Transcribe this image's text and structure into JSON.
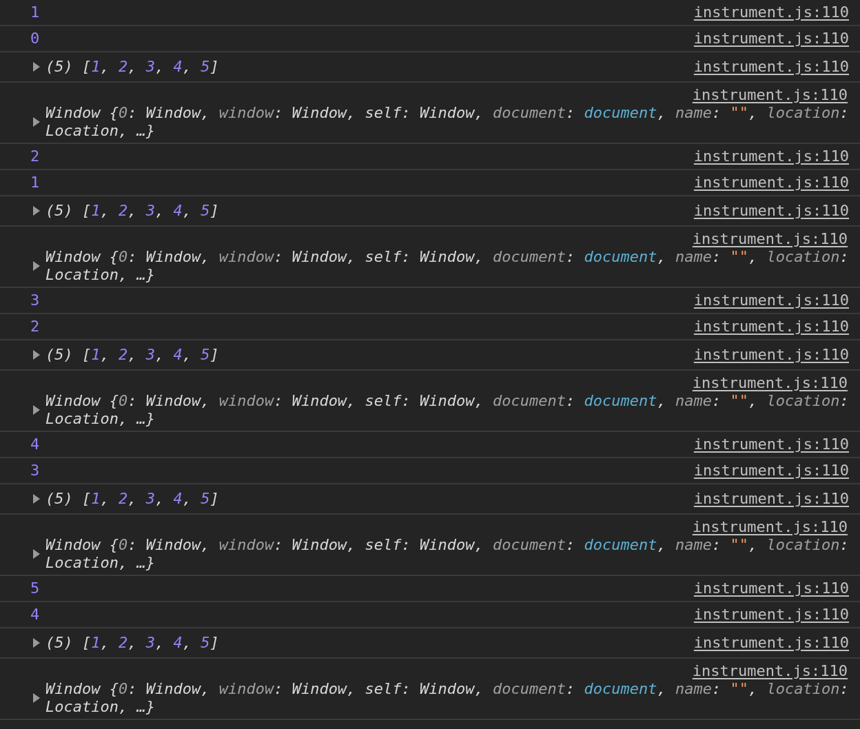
{
  "console": {
    "messages": [
      {
        "kind": "number",
        "value": "1",
        "source": "instrument.js:110"
      },
      {
        "kind": "number",
        "value": "0",
        "source": "instrument.js:110"
      },
      {
        "kind": "array",
        "expanded": false,
        "source": "instrument.js:110",
        "parts": [
          {
            "text": "(5) [",
            "color": "#d8d8d8"
          },
          {
            "text": "1",
            "color": "#9980ff"
          },
          {
            "text": ", ",
            "color": "#d8d8d8"
          },
          {
            "text": "2",
            "color": "#9980ff"
          },
          {
            "text": ", ",
            "color": "#d8d8d8"
          },
          {
            "text": "3",
            "color": "#9980ff"
          },
          {
            "text": ", ",
            "color": "#d8d8d8"
          },
          {
            "text": "4",
            "color": "#9980ff"
          },
          {
            "text": ", ",
            "color": "#d8d8d8"
          },
          {
            "text": "5",
            "color": "#9980ff"
          },
          {
            "text": "]",
            "color": "#d8d8d8"
          }
        ]
      },
      {
        "kind": "object",
        "expanded": false,
        "source": "instrument.js:110",
        "parts": [
          {
            "text": "Window {",
            "color": "#d8d8d8"
          },
          {
            "text": "0",
            "color": "#a0a0a0"
          },
          {
            "text": ": Window, ",
            "color": "#d8d8d8"
          },
          {
            "text": "window",
            "color": "#a0a0a0"
          },
          {
            "text": ": Window, self: Window, ",
            "color": "#d8d8d8"
          },
          {
            "text": "document",
            "color": "#a0a0a0"
          },
          {
            "text": ": ",
            "color": "#d8d8d8"
          },
          {
            "text": "document",
            "color": "#5db0d7"
          },
          {
            "text": ", ",
            "color": "#d8d8d8"
          },
          {
            "text": "name",
            "color": "#a0a0a0"
          },
          {
            "text": ": ",
            "color": "#d8d8d8"
          },
          {
            "text": "\"\"",
            "color": "#f29766"
          },
          {
            "text": ", ",
            "color": "#d8d8d8"
          },
          {
            "text": "location",
            "color": "#a0a0a0"
          },
          {
            "text": ": Location, …}",
            "color": "#d8d8d8"
          }
        ]
      },
      {
        "kind": "number",
        "value": "2",
        "source": "instrument.js:110"
      },
      {
        "kind": "number",
        "value": "1",
        "source": "instrument.js:110"
      },
      {
        "kind": "array",
        "expanded": false,
        "source": "instrument.js:110",
        "parts": [
          {
            "text": "(5) [",
            "color": "#d8d8d8"
          },
          {
            "text": "1",
            "color": "#9980ff"
          },
          {
            "text": ", ",
            "color": "#d8d8d8"
          },
          {
            "text": "2",
            "color": "#9980ff"
          },
          {
            "text": ", ",
            "color": "#d8d8d8"
          },
          {
            "text": "3",
            "color": "#9980ff"
          },
          {
            "text": ", ",
            "color": "#d8d8d8"
          },
          {
            "text": "4",
            "color": "#9980ff"
          },
          {
            "text": ", ",
            "color": "#d8d8d8"
          },
          {
            "text": "5",
            "color": "#9980ff"
          },
          {
            "text": "]",
            "color": "#d8d8d8"
          }
        ]
      },
      {
        "kind": "object",
        "expanded": false,
        "source": "instrument.js:110",
        "parts": [
          {
            "text": "Window {",
            "color": "#d8d8d8"
          },
          {
            "text": "0",
            "color": "#a0a0a0"
          },
          {
            "text": ": Window, ",
            "color": "#d8d8d8"
          },
          {
            "text": "window",
            "color": "#a0a0a0"
          },
          {
            "text": ": Window, self: Window, ",
            "color": "#d8d8d8"
          },
          {
            "text": "document",
            "color": "#a0a0a0"
          },
          {
            "text": ": ",
            "color": "#d8d8d8"
          },
          {
            "text": "document",
            "color": "#5db0d7"
          },
          {
            "text": ", ",
            "color": "#d8d8d8"
          },
          {
            "text": "name",
            "color": "#a0a0a0"
          },
          {
            "text": ": ",
            "color": "#d8d8d8"
          },
          {
            "text": "\"\"",
            "color": "#f29766"
          },
          {
            "text": ", ",
            "color": "#d8d8d8"
          },
          {
            "text": "location",
            "color": "#a0a0a0"
          },
          {
            "text": ": Location, …}",
            "color": "#d8d8d8"
          }
        ]
      },
      {
        "kind": "number",
        "value": "3",
        "source": "instrument.js:110"
      },
      {
        "kind": "number",
        "value": "2",
        "source": "instrument.js:110"
      },
      {
        "kind": "array",
        "expanded": false,
        "source": "instrument.js:110",
        "parts": [
          {
            "text": "(5) [",
            "color": "#d8d8d8"
          },
          {
            "text": "1",
            "color": "#9980ff"
          },
          {
            "text": ", ",
            "color": "#d8d8d8"
          },
          {
            "text": "2",
            "color": "#9980ff"
          },
          {
            "text": ", ",
            "color": "#d8d8d8"
          },
          {
            "text": "3",
            "color": "#9980ff"
          },
          {
            "text": ", ",
            "color": "#d8d8d8"
          },
          {
            "text": "4",
            "color": "#9980ff"
          },
          {
            "text": ", ",
            "color": "#d8d8d8"
          },
          {
            "text": "5",
            "color": "#9980ff"
          },
          {
            "text": "]",
            "color": "#d8d8d8"
          }
        ]
      },
      {
        "kind": "object",
        "expanded": false,
        "source": "instrument.js:110",
        "parts": [
          {
            "text": "Window {",
            "color": "#d8d8d8"
          },
          {
            "text": "0",
            "color": "#a0a0a0"
          },
          {
            "text": ": Window, ",
            "color": "#d8d8d8"
          },
          {
            "text": "window",
            "color": "#a0a0a0"
          },
          {
            "text": ": Window, self: Window, ",
            "color": "#d8d8d8"
          },
          {
            "text": "document",
            "color": "#a0a0a0"
          },
          {
            "text": ": ",
            "color": "#d8d8d8"
          },
          {
            "text": "document",
            "color": "#5db0d7"
          },
          {
            "text": ", ",
            "color": "#d8d8d8"
          },
          {
            "text": "name",
            "color": "#a0a0a0"
          },
          {
            "text": ": ",
            "color": "#d8d8d8"
          },
          {
            "text": "\"\"",
            "color": "#f29766"
          },
          {
            "text": ", ",
            "color": "#d8d8d8"
          },
          {
            "text": "location",
            "color": "#a0a0a0"
          },
          {
            "text": ": Location, …}",
            "color": "#d8d8d8"
          }
        ]
      },
      {
        "kind": "number",
        "value": "4",
        "source": "instrument.js:110"
      },
      {
        "kind": "number",
        "value": "3",
        "source": "instrument.js:110"
      },
      {
        "kind": "array",
        "expanded": false,
        "source": "instrument.js:110",
        "parts": [
          {
            "text": "(5) [",
            "color": "#d8d8d8"
          },
          {
            "text": "1",
            "color": "#9980ff"
          },
          {
            "text": ", ",
            "color": "#d8d8d8"
          },
          {
            "text": "2",
            "color": "#9980ff"
          },
          {
            "text": ", ",
            "color": "#d8d8d8"
          },
          {
            "text": "3",
            "color": "#9980ff"
          },
          {
            "text": ", ",
            "color": "#d8d8d8"
          },
          {
            "text": "4",
            "color": "#9980ff"
          },
          {
            "text": ", ",
            "color": "#d8d8d8"
          },
          {
            "text": "5",
            "color": "#9980ff"
          },
          {
            "text": "]",
            "color": "#d8d8d8"
          }
        ]
      },
      {
        "kind": "object",
        "expanded": false,
        "source": "instrument.js:110",
        "parts": [
          {
            "text": "Window {",
            "color": "#d8d8d8"
          },
          {
            "text": "0",
            "color": "#a0a0a0"
          },
          {
            "text": ": Window, ",
            "color": "#d8d8d8"
          },
          {
            "text": "window",
            "color": "#a0a0a0"
          },
          {
            "text": ": Window, self: Window, ",
            "color": "#d8d8d8"
          },
          {
            "text": "document",
            "color": "#a0a0a0"
          },
          {
            "text": ": ",
            "color": "#d8d8d8"
          },
          {
            "text": "document",
            "color": "#5db0d7"
          },
          {
            "text": ", ",
            "color": "#d8d8d8"
          },
          {
            "text": "name",
            "color": "#a0a0a0"
          },
          {
            "text": ": ",
            "color": "#d8d8d8"
          },
          {
            "text": "\"\"",
            "color": "#f29766"
          },
          {
            "text": ", ",
            "color": "#d8d8d8"
          },
          {
            "text": "location",
            "color": "#a0a0a0"
          },
          {
            "text": ": Location, …}",
            "color": "#d8d8d8"
          }
        ]
      },
      {
        "kind": "number",
        "value": "5",
        "source": "instrument.js:110"
      },
      {
        "kind": "number",
        "value": "4",
        "source": "instrument.js:110"
      },
      {
        "kind": "array",
        "expanded": false,
        "source": "instrument.js:110",
        "parts": [
          {
            "text": "(5) [",
            "color": "#d8d8d8"
          },
          {
            "text": "1",
            "color": "#9980ff"
          },
          {
            "text": ", ",
            "color": "#d8d8d8"
          },
          {
            "text": "2",
            "color": "#9980ff"
          },
          {
            "text": ", ",
            "color": "#d8d8d8"
          },
          {
            "text": "3",
            "color": "#9980ff"
          },
          {
            "text": ", ",
            "color": "#d8d8d8"
          },
          {
            "text": "4",
            "color": "#9980ff"
          },
          {
            "text": ", ",
            "color": "#d8d8d8"
          },
          {
            "text": "5",
            "color": "#9980ff"
          },
          {
            "text": "]",
            "color": "#d8d8d8"
          }
        ]
      },
      {
        "kind": "object",
        "expanded": false,
        "source": "instrument.js:110",
        "parts": [
          {
            "text": "Window {",
            "color": "#d8d8d8"
          },
          {
            "text": "0",
            "color": "#a0a0a0"
          },
          {
            "text": ": Window, ",
            "color": "#d8d8d8"
          },
          {
            "text": "window",
            "color": "#a0a0a0"
          },
          {
            "text": ": Window, self: Window, ",
            "color": "#d8d8d8"
          },
          {
            "text": "document",
            "color": "#a0a0a0"
          },
          {
            "text": ": ",
            "color": "#d8d8d8"
          },
          {
            "text": "document",
            "color": "#5db0d7"
          },
          {
            "text": ", ",
            "color": "#d8d8d8"
          },
          {
            "text": "name",
            "color": "#a0a0a0"
          },
          {
            "text": ": ",
            "color": "#d8d8d8"
          },
          {
            "text": "\"\"",
            "color": "#f29766"
          },
          {
            "text": ", ",
            "color": "#d8d8d8"
          },
          {
            "text": "location",
            "color": "#a0a0a0"
          },
          {
            "text": ": Location, …}",
            "color": "#d8d8d8"
          }
        ]
      }
    ]
  }
}
